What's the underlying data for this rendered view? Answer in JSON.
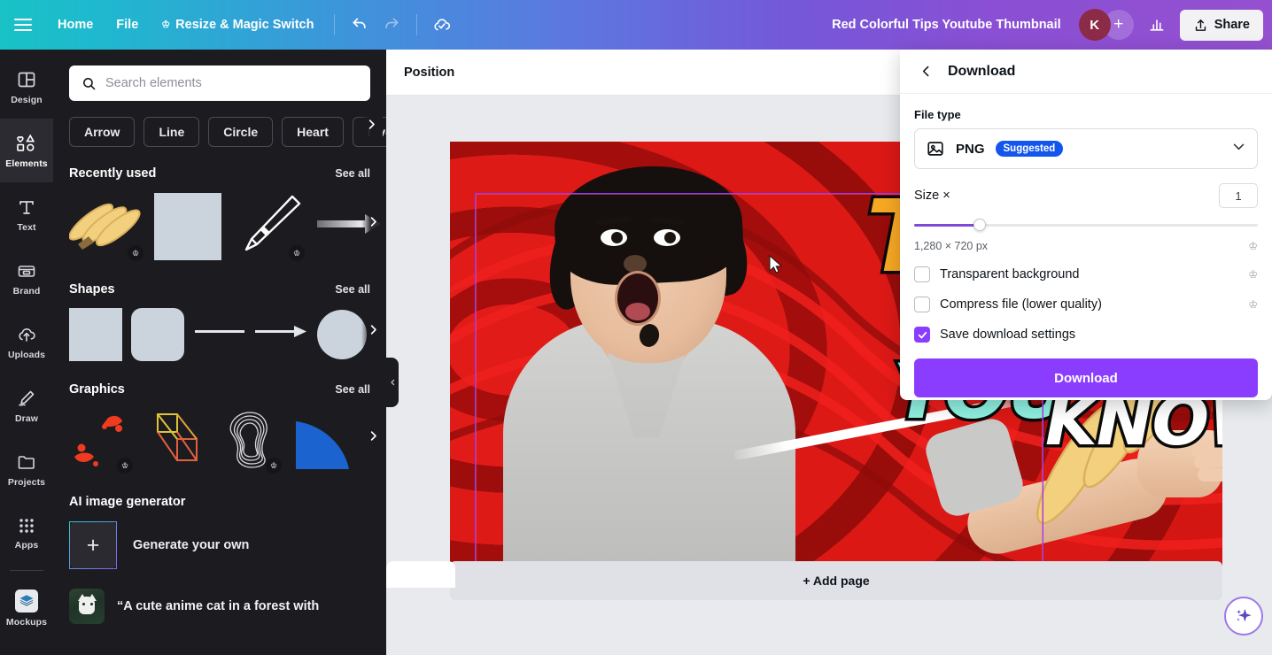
{
  "header": {
    "menu_icon": "hamburger-icon",
    "items": [
      {
        "label": "Home",
        "icon": null
      },
      {
        "label": "File",
        "icon": null
      },
      {
        "label": "Resize & Magic Switch",
        "icon": "crown-icon"
      }
    ],
    "undo_icon": "undo-icon",
    "redo_icon": "redo-icon",
    "cloud_icon": "cloud-saved-icon",
    "doc_title": "Red Colorful Tips Youtube Thumbnail",
    "avatar_initial": "K",
    "add_person_label": "+",
    "analytics_icon": "bar-chart-icon",
    "share_label": "Share",
    "share_icon": "upload-share-icon",
    "gradient_start": "#18c2c5",
    "gradient_end": "#9450cf"
  },
  "rail": {
    "items": [
      {
        "label": "Design",
        "icon": "design-layout-icon",
        "active": false
      },
      {
        "label": "Elements",
        "icon": "elements-shapes-icon",
        "active": true
      },
      {
        "label": "Text",
        "icon": "text-t-icon",
        "active": false
      },
      {
        "label": "Brand",
        "icon": "brand-wallet-icon",
        "active": false
      },
      {
        "label": "Uploads",
        "icon": "upload-cloud-icon",
        "active": false
      },
      {
        "label": "Draw",
        "icon": "draw-pen-icon",
        "active": false
      },
      {
        "label": "Projects",
        "icon": "projects-folder-icon",
        "active": false
      },
      {
        "label": "Apps",
        "icon": "apps-grid-icon",
        "active": false
      },
      {
        "label": "Mockups",
        "icon": "mockups-stack-icon",
        "active": false
      }
    ]
  },
  "panel": {
    "search": {
      "placeholder": "Search elements",
      "icon": "search-icon"
    },
    "chips": [
      "Arrow",
      "Line",
      "Circle",
      "Heart",
      "Live"
    ],
    "chips_more_icon": "chevron-right-icon",
    "sections": [
      {
        "title": "Recently used",
        "see_all": "See all"
      },
      {
        "title": "Shapes",
        "see_all": "See all"
      },
      {
        "title": "Graphics",
        "see_all": "See all"
      }
    ],
    "ai": {
      "title": "AI image generator",
      "generate_label": "Generate your own",
      "generate_icon": "plus-icon",
      "prompt_text": "“A cute anime cat in a forest with"
    },
    "collapse_icon": "chevron-left-icon"
  },
  "stage": {
    "position_label": "Position",
    "add_page_label": "+ Add page",
    "magic_icon": "magic-sparkle-icon",
    "cursor_icon": "mouse-cursor-icon"
  },
  "design": {
    "text_top": "TOP",
    "text_you": "YOU",
    "text_know": "KNOW",
    "color_top": "#f7a823",
    "color_you": "#8ff0df",
    "color_know": "#ffffff",
    "bg_color": "#d41613"
  },
  "download": {
    "back_icon": "chevron-left-icon",
    "title": "Download",
    "file_type_label": "File type",
    "file_type_value": "PNG",
    "file_type_icon": "image-file-icon",
    "file_type_badge": "Suggested",
    "dropdown_icon": "chevron-down-icon",
    "size_label": "Size ×",
    "size_value": "1",
    "size_px": "1,280 × 720 px",
    "crown_icon": "crown-icon",
    "options": [
      {
        "label": "Transparent background",
        "checked": false,
        "pro": true
      },
      {
        "label": "Compress file (lower quality)",
        "checked": false,
        "pro": true
      },
      {
        "label": "Save download settings",
        "checked": true,
        "pro": false
      }
    ],
    "button_label": "Download",
    "accent_color": "#8b3dff",
    "badge_color": "#1356ee"
  }
}
